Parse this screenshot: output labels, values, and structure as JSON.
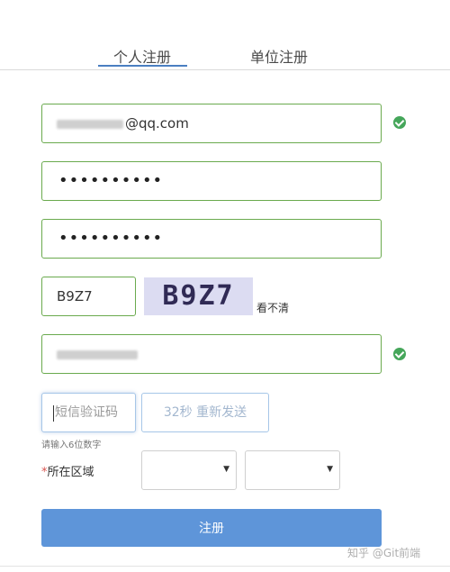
{
  "tabs": {
    "personal": "个人注册",
    "unit": "单位注册"
  },
  "form": {
    "email_suffix": "@qq.com",
    "password_mask": "••••••••••",
    "password_confirm_mask": "••••••••••",
    "captcha_value": "B9Z7",
    "captcha_image_text": "B9Z7",
    "captcha_refresh": "看不清",
    "sms_placeholder": "短信验证码",
    "sms_button": "32秒 重新发送",
    "sms_hint": "请输入6位数字",
    "region_required_mark": "*",
    "region_label": "所在区域",
    "submit": "注册"
  },
  "watermark": "知乎 @Git前端",
  "colors": {
    "valid_border": "#6aaa4e",
    "check": "#45a65a",
    "accent": "#5e95d9"
  }
}
